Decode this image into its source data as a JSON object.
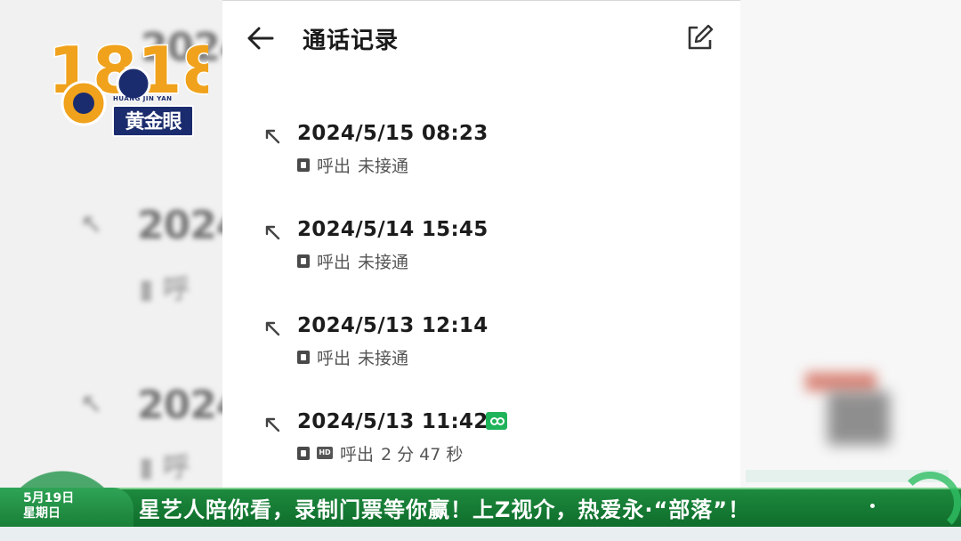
{
  "header": {
    "title": "通话记录"
  },
  "calls": [
    {
      "datetime": "2024/5/15 08:23",
      "direction": "呼出",
      "status": "未接通",
      "hd": false,
      "recorded": false
    },
    {
      "datetime": "2024/5/14 15:45",
      "direction": "呼出",
      "status": "未接通",
      "hd": false,
      "recorded": false
    },
    {
      "datetime": "2024/5/13 12:14",
      "direction": "呼出",
      "status": "未接通",
      "hd": false,
      "recorded": false
    },
    {
      "datetime": "2024/5/13 11:42",
      "direction": "呼出",
      "status": "2 分 47 秒",
      "hd": true,
      "recorded": true
    }
  ],
  "background_ghost": {
    "dates": [
      "2024",
      "2024",
      "2024",
      "2024"
    ]
  },
  "logo": {
    "number": "1818",
    "tagline": "HUANG JIN YAN",
    "name": "黄金眼"
  },
  "ticker": {
    "date": "5月19日",
    "weekday": "星期日",
    "text": "星艺人陪你看，录制门票等你赢！上Z视介，热爱永·“部落”！"
  },
  "colors": {
    "accent_green": "#1d8a3e",
    "record_badge": "#1fb35a",
    "logo_blue": "#1b2c6e",
    "logo_orange": "#f0a21c"
  },
  "icons": {
    "back": "arrow-left-icon",
    "edit": "edit-icon",
    "call_direction": "outgoing-call-arrow-icon",
    "sim": "sim-card-icon",
    "hd": "hd-icon",
    "recording": "recording-icon"
  }
}
